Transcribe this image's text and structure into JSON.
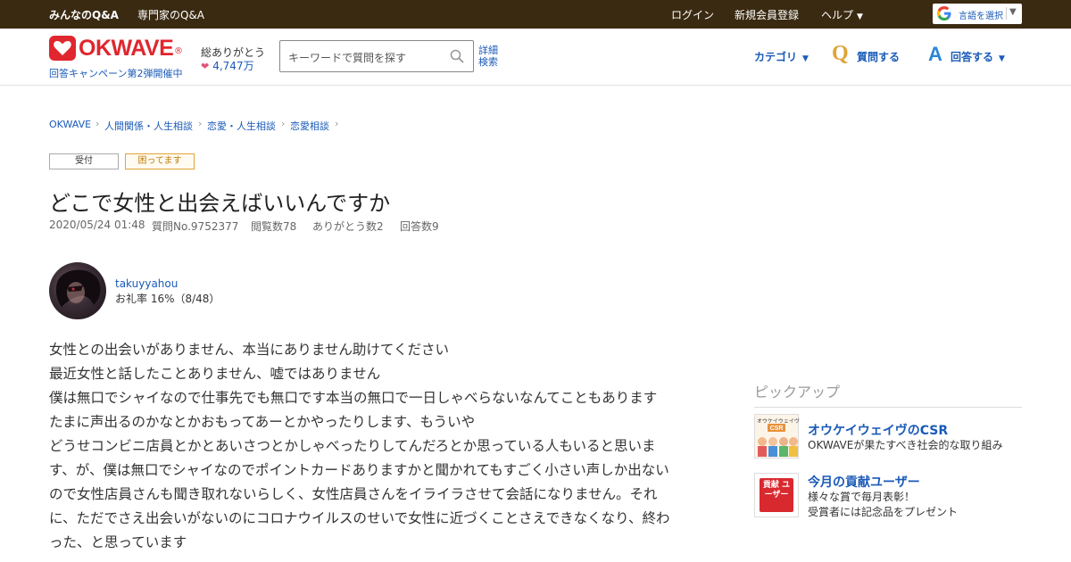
{
  "topbar": {
    "left_links": [
      "みんなのQ&A",
      "専門家のQ&A"
    ],
    "right_links": [
      "ログイン",
      "新規会員登録",
      "ヘルプ"
    ],
    "language_label": "言語を選択"
  },
  "header": {
    "logo_text": "OKWAVE",
    "campaign_text": "回答キャンペーン第2弾開催中",
    "thanks_label": "総ありがとう",
    "thanks_value": "4,747万",
    "search_placeholder": "キーワードで質問を探す",
    "advanced_search": "詳細検索",
    "nav": {
      "category": "カテゴリ",
      "ask": "質問する",
      "answer": "回答する"
    }
  },
  "breadcrumb": [
    "OKWAVE",
    "人間関係・人生相談",
    "恋愛・人生相談",
    "恋愛相談"
  ],
  "question": {
    "status_badges": [
      "受付",
      "困ってます"
    ],
    "title": "どこで女性と出会えばいいんですか",
    "meta": {
      "date": "2020/05/24 01:48",
      "question_no": "質問No.9752377",
      "views": "閲覧数78",
      "thanks": "ありがとう数2",
      "answers": "回答数9"
    },
    "author": {
      "name": "takuyyahou",
      "rate": "お礼率 16%（8/48）"
    },
    "body_lines": [
      "女性との出会いがありません、本当にありません助けてください",
      "最近女性と話したことありません、嘘ではありません",
      "僕は無口でシャイなので仕事先でも無口です本当の無口で一日しゃべらないなんてこともあります",
      "たまに声出るのかなとかおもってあーとかやったりします、もういや",
      "どうせコンビニ店員とかとあいさつとかしゃべったりしてんだろとか思っている人もいると思いま",
      "す、が、僕は無口でシャイなのでポイントカードありますかと聞かれてもすごく小さい声しか出ない",
      "ので女性店員さんも聞き取れないらしく、女性店員さんをイライラさせて会話になりません。それ",
      "に、ただでさえ出会いがないのにコロナウイルスのせいで女性に近づくことさえできなくなり、終わ",
      "った、と思っています"
    ]
  },
  "pickup": {
    "heading": "ピックアップ",
    "items": [
      {
        "title": "オウケイウェイヴのCSR",
        "desc": "OKWAVEが果たすべき社会的な取り組み",
        "thumb_label": "オウケイウェイヴ"
      },
      {
        "title": "今月の貢献ユーザー",
        "desc": "様々な賞で毎月表彰！",
        "desc2": "受賞者には記念品をプレゼント",
        "thumb_label": "貢献 ユーザー"
      }
    ]
  },
  "colors": {
    "topbar": "#3a2a12",
    "link": "#1a5ab8",
    "brand_red": "#e0262e",
    "q_icon": "#e0a335",
    "a_icon": "#2a86d6"
  }
}
